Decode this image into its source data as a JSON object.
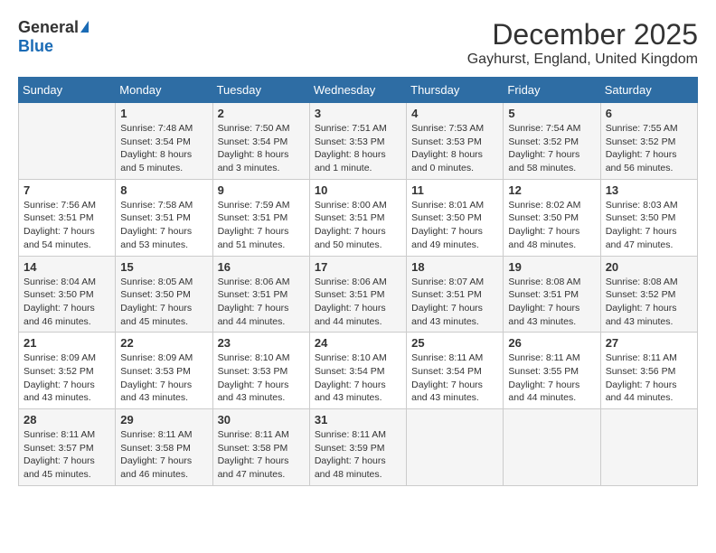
{
  "logo": {
    "general": "General",
    "blue": "Blue"
  },
  "title": "December 2025",
  "location": "Gayhurst, England, United Kingdom",
  "days_header": [
    "Sunday",
    "Monday",
    "Tuesday",
    "Wednesday",
    "Thursday",
    "Friday",
    "Saturday"
  ],
  "weeks": [
    [
      {
        "day": "",
        "info": ""
      },
      {
        "day": "1",
        "info": "Sunrise: 7:48 AM\nSunset: 3:54 PM\nDaylight: 8 hours\nand 5 minutes."
      },
      {
        "day": "2",
        "info": "Sunrise: 7:50 AM\nSunset: 3:54 PM\nDaylight: 8 hours\nand 3 minutes."
      },
      {
        "day": "3",
        "info": "Sunrise: 7:51 AM\nSunset: 3:53 PM\nDaylight: 8 hours\nand 1 minute."
      },
      {
        "day": "4",
        "info": "Sunrise: 7:53 AM\nSunset: 3:53 PM\nDaylight: 8 hours\nand 0 minutes."
      },
      {
        "day": "5",
        "info": "Sunrise: 7:54 AM\nSunset: 3:52 PM\nDaylight: 7 hours\nand 58 minutes."
      },
      {
        "day": "6",
        "info": "Sunrise: 7:55 AM\nSunset: 3:52 PM\nDaylight: 7 hours\nand 56 minutes."
      }
    ],
    [
      {
        "day": "7",
        "info": "Sunrise: 7:56 AM\nSunset: 3:51 PM\nDaylight: 7 hours\nand 54 minutes."
      },
      {
        "day": "8",
        "info": "Sunrise: 7:58 AM\nSunset: 3:51 PM\nDaylight: 7 hours\nand 53 minutes."
      },
      {
        "day": "9",
        "info": "Sunrise: 7:59 AM\nSunset: 3:51 PM\nDaylight: 7 hours\nand 51 minutes."
      },
      {
        "day": "10",
        "info": "Sunrise: 8:00 AM\nSunset: 3:51 PM\nDaylight: 7 hours\nand 50 minutes."
      },
      {
        "day": "11",
        "info": "Sunrise: 8:01 AM\nSunset: 3:50 PM\nDaylight: 7 hours\nand 49 minutes."
      },
      {
        "day": "12",
        "info": "Sunrise: 8:02 AM\nSunset: 3:50 PM\nDaylight: 7 hours\nand 48 minutes."
      },
      {
        "day": "13",
        "info": "Sunrise: 8:03 AM\nSunset: 3:50 PM\nDaylight: 7 hours\nand 47 minutes."
      }
    ],
    [
      {
        "day": "14",
        "info": "Sunrise: 8:04 AM\nSunset: 3:50 PM\nDaylight: 7 hours\nand 46 minutes."
      },
      {
        "day": "15",
        "info": "Sunrise: 8:05 AM\nSunset: 3:50 PM\nDaylight: 7 hours\nand 45 minutes."
      },
      {
        "day": "16",
        "info": "Sunrise: 8:06 AM\nSunset: 3:51 PM\nDaylight: 7 hours\nand 44 minutes."
      },
      {
        "day": "17",
        "info": "Sunrise: 8:06 AM\nSunset: 3:51 PM\nDaylight: 7 hours\nand 44 minutes."
      },
      {
        "day": "18",
        "info": "Sunrise: 8:07 AM\nSunset: 3:51 PM\nDaylight: 7 hours\nand 43 minutes."
      },
      {
        "day": "19",
        "info": "Sunrise: 8:08 AM\nSunset: 3:51 PM\nDaylight: 7 hours\nand 43 minutes."
      },
      {
        "day": "20",
        "info": "Sunrise: 8:08 AM\nSunset: 3:52 PM\nDaylight: 7 hours\nand 43 minutes."
      }
    ],
    [
      {
        "day": "21",
        "info": "Sunrise: 8:09 AM\nSunset: 3:52 PM\nDaylight: 7 hours\nand 43 minutes."
      },
      {
        "day": "22",
        "info": "Sunrise: 8:09 AM\nSunset: 3:53 PM\nDaylight: 7 hours\nand 43 minutes."
      },
      {
        "day": "23",
        "info": "Sunrise: 8:10 AM\nSunset: 3:53 PM\nDaylight: 7 hours\nand 43 minutes."
      },
      {
        "day": "24",
        "info": "Sunrise: 8:10 AM\nSunset: 3:54 PM\nDaylight: 7 hours\nand 43 minutes."
      },
      {
        "day": "25",
        "info": "Sunrise: 8:11 AM\nSunset: 3:54 PM\nDaylight: 7 hours\nand 43 minutes."
      },
      {
        "day": "26",
        "info": "Sunrise: 8:11 AM\nSunset: 3:55 PM\nDaylight: 7 hours\nand 44 minutes."
      },
      {
        "day": "27",
        "info": "Sunrise: 8:11 AM\nSunset: 3:56 PM\nDaylight: 7 hours\nand 44 minutes."
      }
    ],
    [
      {
        "day": "28",
        "info": "Sunrise: 8:11 AM\nSunset: 3:57 PM\nDaylight: 7 hours\nand 45 minutes."
      },
      {
        "day": "29",
        "info": "Sunrise: 8:11 AM\nSunset: 3:58 PM\nDaylight: 7 hours\nand 46 minutes."
      },
      {
        "day": "30",
        "info": "Sunrise: 8:11 AM\nSunset: 3:58 PM\nDaylight: 7 hours\nand 47 minutes."
      },
      {
        "day": "31",
        "info": "Sunrise: 8:11 AM\nSunset: 3:59 PM\nDaylight: 7 hours\nand 48 minutes."
      },
      {
        "day": "",
        "info": ""
      },
      {
        "day": "",
        "info": ""
      },
      {
        "day": "",
        "info": ""
      }
    ]
  ]
}
